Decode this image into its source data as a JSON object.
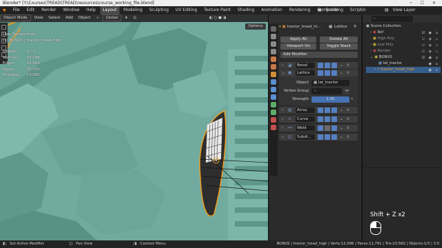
{
  "titlebar": {
    "title": "Blender* [Y:\\Courses\\TREAD\\TREAD\\resources\\course_working_file.blend]",
    "controls": "─ ☐ ✕"
  },
  "menu": {
    "logo": "◆",
    "items": [
      "File",
      "Edit",
      "Render",
      "Window",
      "Help"
    ],
    "workspaces": [
      "Layout",
      "Modeling",
      "Sculpting",
      "UV Editing",
      "Texture Paint",
      "Shading",
      "Animation",
      "Rendering",
      "Compositing",
      "Scriptin"
    ],
    "active_workspace": "Layout",
    "scene": "Scene",
    "view_layer": "View Layer"
  },
  "viewport": {
    "mode": "Object Mode",
    "menus": [
      "View",
      "Select",
      "Add",
      "Object"
    ],
    "transform": "Global",
    "options": "Options",
    "view_name": "User Perspective",
    "object_info": "(1) BONUS | tractor_tread_high",
    "stats": [
      {
        "label": "Objects",
        "value": "1 / 3"
      },
      {
        "label": "Vertices",
        "value": "12,096"
      },
      {
        "label": "Edges",
        "value": "23,913"
      },
      {
        "label": "Faces",
        "value": "11,791"
      },
      {
        "label": "Triangles",
        "value": "23,582"
      }
    ],
    "colors": {
      "mesh": "#6ea89c",
      "selection": "#f39a1e"
    }
  },
  "properties": {
    "object_name": "tractor_tread_hi...",
    "modifier_target": "Lattice",
    "apply_all": "Apply All",
    "delete_all": "Delete All",
    "viewport_vis": "Viewport Vis",
    "toggle_stack": "Toggle Stack",
    "add_modifier": "Add Modifier",
    "modifiers": [
      {
        "name": "Bevel"
      },
      {
        "name": "Lattice"
      },
      {
        "name": "Array"
      },
      {
        "name": "Curve"
      },
      {
        "name": "Weld"
      },
      {
        "name": "Subdi..."
      }
    ],
    "lattice_settings": {
      "object_label": "Object",
      "object_value": "lat_tractor",
      "vertex_group_label": "Vertex Group",
      "strength_label": "Strength",
      "strength_value": "1.00"
    }
  },
  "outliner": {
    "title": "Scene Collection",
    "items": [
      {
        "name": "Ref",
        "color": "#d04c4c"
      },
      {
        "name": "High Poly",
        "color": "#d5c03a"
      },
      {
        "name": "Low Poly",
        "color": "#d5c03a"
      },
      {
        "name": "Render",
        "color": "#d04c4c"
      },
      {
        "name": "BONUS",
        "color": "#d5c03a"
      },
      {
        "name": "lat_tractor",
        "color": "#7fb6e6"
      },
      {
        "name": "tractor_tread_high",
        "color": "#f39a1e"
      }
    ]
  },
  "keystroke": {
    "text": "Shift + Z x2"
  },
  "statusbar": {
    "left": "Set Active Modifier",
    "mid1": "Pan View",
    "mid2": "Context Menu",
    "right": "BONUS | tractor_tread_high | Verts:12,096 | Faces:11,791 | Tris:23,582 | Objects:1/3 | 3.0"
  }
}
